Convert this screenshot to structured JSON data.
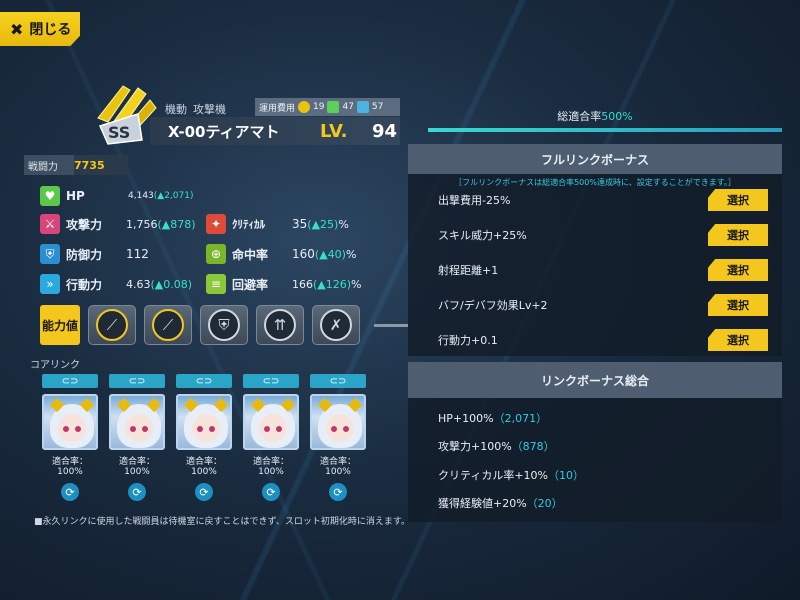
{
  "close_label": "閉じる",
  "unit": {
    "category": "機動",
    "type": "攻撃機",
    "cost_label": "運用費用",
    "cost_values": [
      "19",
      "47",
      "57"
    ],
    "name": "X-00ティアマト",
    "lv_label": "LV.",
    "level": "94",
    "power_label": "戦闘力",
    "power_value": "7735",
    "rank_badge": "SS"
  },
  "stats": {
    "hp": {
      "label": "HP",
      "value": "4,143",
      "bonus": "(▲2,071)"
    },
    "attack": {
      "label": "攻撃力",
      "value": "1,756",
      "bonus": "(▲878)"
    },
    "defense": {
      "label": "防御力",
      "value": "112",
      "bonus": ""
    },
    "action": {
      "label": "行動力",
      "value": "4.63",
      "bonus": "(▲0.08)"
    },
    "critical": {
      "label": "ｸﾘﾃｨｶﾙ",
      "value": "35",
      "bonus": "(▲25)",
      "unit": "%"
    },
    "accuracy": {
      "label": "命中率",
      "value": "160",
      "bonus": "(▲40)",
      "unit": "%"
    },
    "evasion": {
      "label": "回避率",
      "value": "166",
      "bonus": "(▲126)",
      "unit": "%"
    }
  },
  "ability_label": "能力値",
  "corelink": {
    "title": "コアリンク",
    "cards": [
      {
        "fit_label": "適合率：100%"
      },
      {
        "fit_label": "適合率：100%"
      },
      {
        "fit_label": "適合率：100%"
      },
      {
        "fit_label": "適合率：100%"
      },
      {
        "fit_label": "適合率：100%"
      }
    ],
    "note": "■永久リンクに使用した戦闘員は待機室に戻すことはできず、スロット初期化時に消えます。"
  },
  "right": {
    "total_fit_label": "総適合率",
    "total_fit_value": "500%",
    "full_link": {
      "title": "フルリンクボーナス",
      "note": "［フルリンクボーナスは総適合率500%達成時に、設定することができます。］",
      "select_label": "選択",
      "items": [
        "出撃費用-25%",
        "スキル威力+25%",
        "射程距離+1",
        "バフ/デバフ効果Lv+2",
        "行動力+0.1"
      ]
    },
    "link_total": {
      "title": "リンクボーナス総合",
      "items": [
        {
          "text": "HP+100%",
          "extra": "（2,071）"
        },
        {
          "text": "攻撃力+100%",
          "extra": "（878）"
        },
        {
          "text": "クリティカル率+10%",
          "extra": "（10）"
        },
        {
          "text": "獲得経験値+20%",
          "extra": "（20）"
        }
      ]
    }
  },
  "colors": {
    "accent": "#f3c71e",
    "teal": "#39c8e0",
    "panel": "#4e5d6f"
  }
}
